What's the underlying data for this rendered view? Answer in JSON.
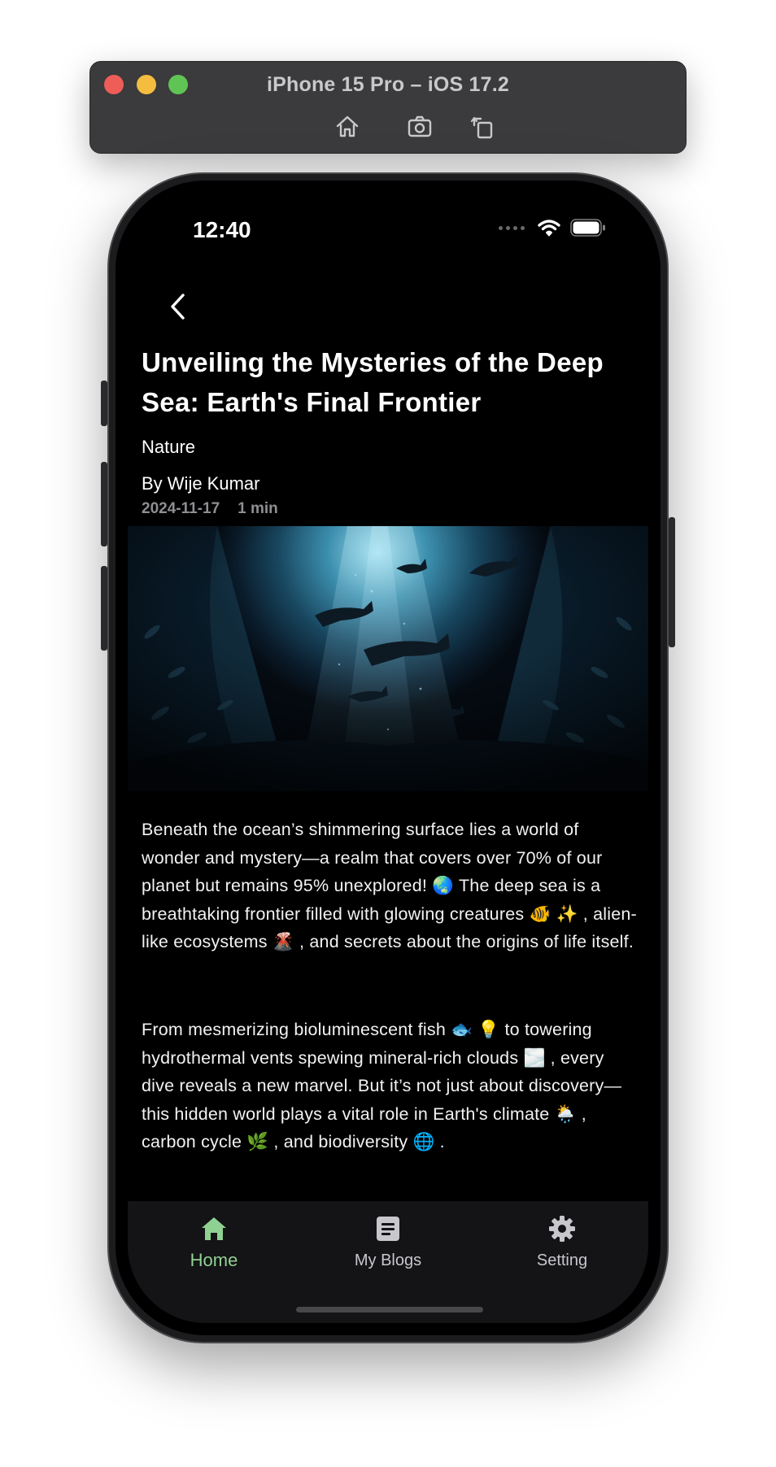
{
  "simulator": {
    "title": "iPhone 15 Pro – iOS 17.2",
    "toolbar": [
      "home-icon",
      "screenshot-icon",
      "rotate-icon"
    ]
  },
  "status_bar": {
    "time": "12:40"
  },
  "article": {
    "title": "Unveiling the Mysteries of the Deep Sea: Earth's Final Frontier",
    "category": "Nature",
    "author": "By Wije Kumar",
    "date": "2024-11-17",
    "read_time": "1 min",
    "paragraph_1": "Beneath the ocean’s shimmering surface lies a world of wonder and mystery—a realm that covers over 70% of our planet but remains 95% unexplored! 🌏 The deep sea is a breathtaking frontier filled with glowing creatures 🐠 ✨ , alien-like ecosystems 🌋 , and secrets about the origins of life itself.",
    "paragraph_2": "From mesmerizing bioluminescent fish 🐟 💡 to towering hydrothermal vents spewing mineral-rich clouds 🌫️ , every dive reveals a new marvel. But it’s not just about discovery—this hidden world plays a vital role in Earth's climate 🌦️ , carbon cycle 🌿 , and biodiversity 🌐 ."
  },
  "tabbar": {
    "tabs": [
      {
        "label": "Home",
        "icon": "home-icon",
        "active": true
      },
      {
        "label": "My Blogs",
        "icon": "article-icon",
        "active": false
      },
      {
        "label": "Setting",
        "icon": "gear-icon",
        "active": false
      }
    ]
  },
  "colors": {
    "accent": "#8fd192",
    "background": "#000000",
    "tabbar_bg": "#141316",
    "meta_text": "#8e8e93"
  }
}
